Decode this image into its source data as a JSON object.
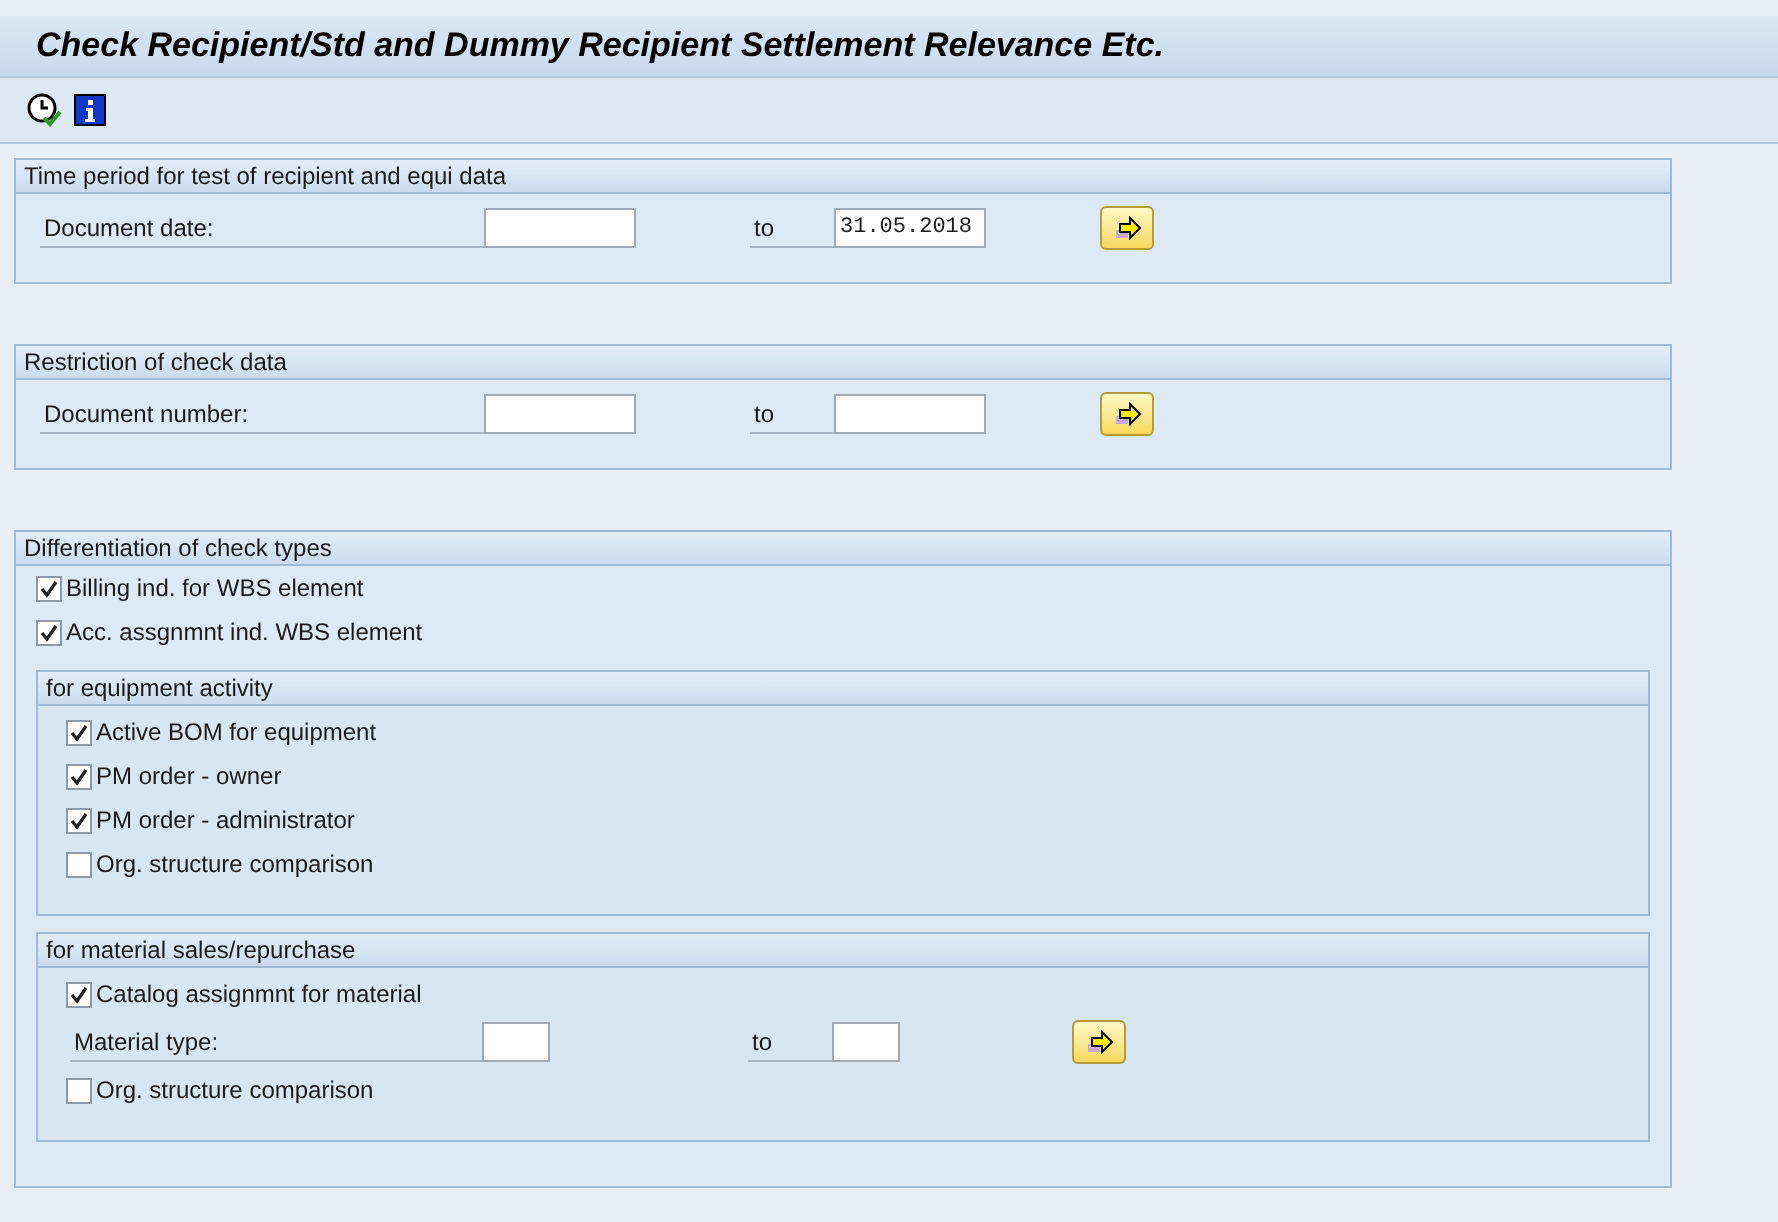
{
  "title": "Check Recipient/Std and Dummy Recipient Settlement Relevance Etc.",
  "groups": [
    {
      "title": "Time period for test of recipient and equi data",
      "items": [
        {
          "kind": "range",
          "label": "Document date:",
          "to_label": "to",
          "to": "31.05.2018"
        }
      ]
    },
    {
      "title": "Restriction of check data",
      "items": [
        {
          "kind": "range",
          "label": "Document number:",
          "to_label": "to"
        }
      ]
    },
    {
      "title": "Differentiation of check types",
      "items": [
        {
          "kind": "checkbox",
          "label": "Billing ind. for WBS element",
          "checked": true
        },
        {
          "kind": "checkbox",
          "label": "Acc. assgnmnt ind. WBS element",
          "checked": true
        },
        {
          "kind": "group",
          "title": "for equipment activity",
          "items": [
            {
              "kind": "checkbox",
              "label": "Active BOM for equipment",
              "checked": true
            },
            {
              "kind": "checkbox",
              "label": "PM order - owner",
              "checked": true
            },
            {
              "kind": "checkbox",
              "label": "PM order - administrator",
              "checked": true
            },
            {
              "kind": "checkbox",
              "label": "Org. structure comparison",
              "checked": false
            }
          ]
        },
        {
          "kind": "group",
          "title": "for material sales/repurchase",
          "items": [
            {
              "kind": "checkbox",
              "label": "Catalog assignmnt for material",
              "checked": true
            },
            {
              "kind": "range",
              "label": "Material type:",
              "to_label": "to"
            },
            {
              "kind": "checkbox",
              "label": "Org. structure comparison",
              "checked": false
            }
          ]
        }
      ]
    }
  ]
}
